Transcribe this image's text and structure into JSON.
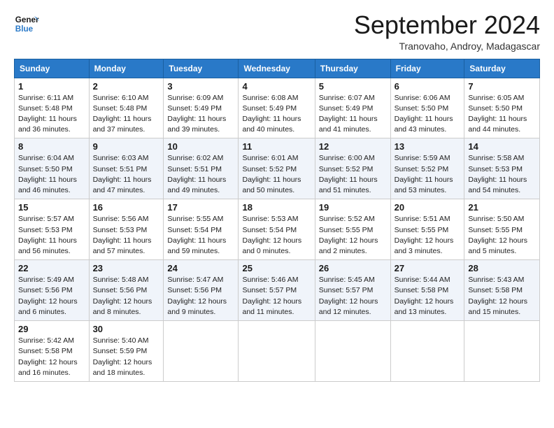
{
  "header": {
    "logo_text_general": "General",
    "logo_text_blue": "Blue",
    "month_title": "September 2024",
    "location": "Tranovaho, Androy, Madagascar"
  },
  "weekdays": [
    "Sunday",
    "Monday",
    "Tuesday",
    "Wednesday",
    "Thursday",
    "Friday",
    "Saturday"
  ],
  "weeks": [
    [
      {
        "day": "1",
        "info": "Sunrise: 6:11 AM\nSunset: 5:48 PM\nDaylight: 11 hours\nand 36 minutes."
      },
      {
        "day": "2",
        "info": "Sunrise: 6:10 AM\nSunset: 5:48 PM\nDaylight: 11 hours\nand 37 minutes."
      },
      {
        "day": "3",
        "info": "Sunrise: 6:09 AM\nSunset: 5:49 PM\nDaylight: 11 hours\nand 39 minutes."
      },
      {
        "day": "4",
        "info": "Sunrise: 6:08 AM\nSunset: 5:49 PM\nDaylight: 11 hours\nand 40 minutes."
      },
      {
        "day": "5",
        "info": "Sunrise: 6:07 AM\nSunset: 5:49 PM\nDaylight: 11 hours\nand 41 minutes."
      },
      {
        "day": "6",
        "info": "Sunrise: 6:06 AM\nSunset: 5:50 PM\nDaylight: 11 hours\nand 43 minutes."
      },
      {
        "day": "7",
        "info": "Sunrise: 6:05 AM\nSunset: 5:50 PM\nDaylight: 11 hours\nand 44 minutes."
      }
    ],
    [
      {
        "day": "8",
        "info": "Sunrise: 6:04 AM\nSunset: 5:50 PM\nDaylight: 11 hours\nand 46 minutes."
      },
      {
        "day": "9",
        "info": "Sunrise: 6:03 AM\nSunset: 5:51 PM\nDaylight: 11 hours\nand 47 minutes."
      },
      {
        "day": "10",
        "info": "Sunrise: 6:02 AM\nSunset: 5:51 PM\nDaylight: 11 hours\nand 49 minutes."
      },
      {
        "day": "11",
        "info": "Sunrise: 6:01 AM\nSunset: 5:52 PM\nDaylight: 11 hours\nand 50 minutes."
      },
      {
        "day": "12",
        "info": "Sunrise: 6:00 AM\nSunset: 5:52 PM\nDaylight: 11 hours\nand 51 minutes."
      },
      {
        "day": "13",
        "info": "Sunrise: 5:59 AM\nSunset: 5:52 PM\nDaylight: 11 hours\nand 53 minutes."
      },
      {
        "day": "14",
        "info": "Sunrise: 5:58 AM\nSunset: 5:53 PM\nDaylight: 11 hours\nand 54 minutes."
      }
    ],
    [
      {
        "day": "15",
        "info": "Sunrise: 5:57 AM\nSunset: 5:53 PM\nDaylight: 11 hours\nand 56 minutes."
      },
      {
        "day": "16",
        "info": "Sunrise: 5:56 AM\nSunset: 5:53 PM\nDaylight: 11 hours\nand 57 minutes."
      },
      {
        "day": "17",
        "info": "Sunrise: 5:55 AM\nSunset: 5:54 PM\nDaylight: 11 hours\nand 59 minutes."
      },
      {
        "day": "18",
        "info": "Sunrise: 5:53 AM\nSunset: 5:54 PM\nDaylight: 12 hours\nand 0 minutes."
      },
      {
        "day": "19",
        "info": "Sunrise: 5:52 AM\nSunset: 5:55 PM\nDaylight: 12 hours\nand 2 minutes."
      },
      {
        "day": "20",
        "info": "Sunrise: 5:51 AM\nSunset: 5:55 PM\nDaylight: 12 hours\nand 3 minutes."
      },
      {
        "day": "21",
        "info": "Sunrise: 5:50 AM\nSunset: 5:55 PM\nDaylight: 12 hours\nand 5 minutes."
      }
    ],
    [
      {
        "day": "22",
        "info": "Sunrise: 5:49 AM\nSunset: 5:56 PM\nDaylight: 12 hours\nand 6 minutes."
      },
      {
        "day": "23",
        "info": "Sunrise: 5:48 AM\nSunset: 5:56 PM\nDaylight: 12 hours\nand 8 minutes."
      },
      {
        "day": "24",
        "info": "Sunrise: 5:47 AM\nSunset: 5:56 PM\nDaylight: 12 hours\nand 9 minutes."
      },
      {
        "day": "25",
        "info": "Sunrise: 5:46 AM\nSunset: 5:57 PM\nDaylight: 12 hours\nand 11 minutes."
      },
      {
        "day": "26",
        "info": "Sunrise: 5:45 AM\nSunset: 5:57 PM\nDaylight: 12 hours\nand 12 minutes."
      },
      {
        "day": "27",
        "info": "Sunrise: 5:44 AM\nSunset: 5:58 PM\nDaylight: 12 hours\nand 13 minutes."
      },
      {
        "day": "28",
        "info": "Sunrise: 5:43 AM\nSunset: 5:58 PM\nDaylight: 12 hours\nand 15 minutes."
      }
    ],
    [
      {
        "day": "29",
        "info": "Sunrise: 5:42 AM\nSunset: 5:58 PM\nDaylight: 12 hours\nand 16 minutes."
      },
      {
        "day": "30",
        "info": "Sunrise: 5:40 AM\nSunset: 5:59 PM\nDaylight: 12 hours\nand 18 minutes."
      },
      null,
      null,
      null,
      null,
      null
    ]
  ]
}
